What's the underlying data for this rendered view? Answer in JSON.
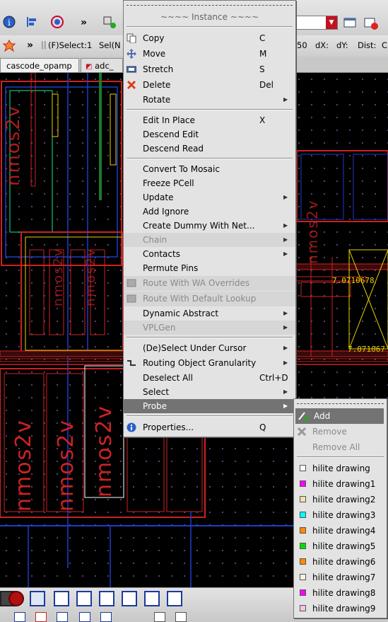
{
  "toolbar_top": {
    "more": "»",
    "combo_value": ""
  },
  "toolbar_second": {
    "more": "»",
    "select_status": "(F)Select:1",
    "sel_status": "Sel(N",
    "readout_value": "50",
    "dx_label": "dX:",
    "dy_label": "dY:",
    "dist_label": "Dist:",
    "trailing": "C"
  },
  "tabs": [
    {
      "label": "cascode_opamp"
    },
    {
      "label": "adc_"
    }
  ],
  "canvas": {
    "cell_label": "nmos2v",
    "measure_1": "7.0710678",
    "measure_2": "7.071067"
  },
  "context_menu": {
    "header": "~~~~ Instance ~~~~",
    "items": [
      {
        "label": "Copy",
        "accel": "C"
      },
      {
        "label": "Move",
        "accel": "M"
      },
      {
        "label": "Stretch",
        "accel": "S"
      },
      {
        "label": "Delete",
        "accel": "Del"
      },
      {
        "label": "Rotate",
        "accel": ""
      },
      {
        "label": "Edit In Place",
        "accel": "X"
      },
      {
        "label": "Descend Edit",
        "accel": ""
      },
      {
        "label": "Descend Read",
        "accel": ""
      },
      {
        "label": "Convert To Mosaic",
        "accel": ""
      },
      {
        "label": "Freeze PCell",
        "accel": ""
      },
      {
        "label": "Update",
        "accel": ""
      },
      {
        "label": "Add Ignore",
        "accel": ""
      },
      {
        "label": "Create Dummy With Net...",
        "accel": ""
      },
      {
        "label": "Chain",
        "accel": ""
      },
      {
        "label": "Contacts",
        "accel": ""
      },
      {
        "label": "Permute Pins",
        "accel": ""
      },
      {
        "label": "Route With WA Overrides",
        "accel": ""
      },
      {
        "label": "Route With Default Lookup",
        "accel": ""
      },
      {
        "label": "Dynamic Abstract",
        "accel": ""
      },
      {
        "label": "VPLGen",
        "accel": ""
      },
      {
        "label": "(De)Select Under Cursor",
        "accel": ""
      },
      {
        "label": "Routing Object Granularity",
        "accel": ""
      },
      {
        "label": "Deselect All",
        "accel": "Ctrl+D"
      },
      {
        "label": "Select",
        "accel": ""
      },
      {
        "label": "Probe",
        "accel": ""
      },
      {
        "label": "Properties...",
        "accel": "Q"
      }
    ]
  },
  "probe_submenu": {
    "items": [
      {
        "label": "Add"
      },
      {
        "label": "Remove"
      },
      {
        "label": "Remove All"
      },
      {
        "label": "hilite drawing",
        "color": "#ffffff"
      },
      {
        "label": "hilite drawing1",
        "color": "#ff00ff"
      },
      {
        "label": "hilite drawing2",
        "color": "#f5deb3"
      },
      {
        "label": "hilite drawing3",
        "color": "#00ffff"
      },
      {
        "label": "hilite drawing4",
        "color": "#ff8c00"
      },
      {
        "label": "hilite drawing5",
        "color": "#00e000"
      },
      {
        "label": "hilite drawing6",
        "color": "#ff8c00"
      },
      {
        "label": "hilite drawing7",
        "color": "#f5f5dc"
      },
      {
        "label": "hilite drawing8",
        "color": "#ff00ff"
      },
      {
        "label": "hilite drawing9",
        "color": "#ffc0e8"
      }
    ]
  },
  "colors": {
    "menu_bg": "#e3e3e3",
    "highlight": "#737373",
    "layout_red": "#c22222",
    "layout_blue": "#1e3cc8",
    "layout_yellow": "#e8d200"
  }
}
